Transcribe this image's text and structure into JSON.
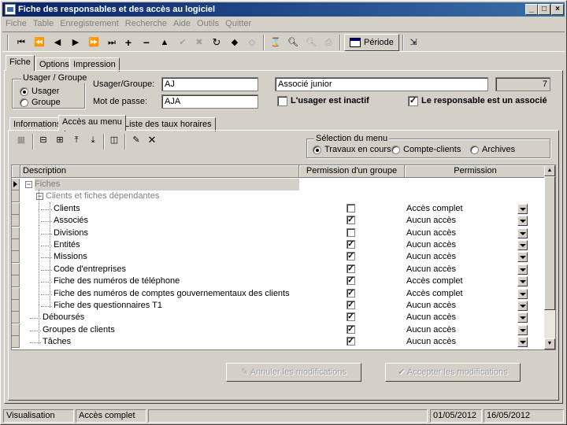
{
  "window": {
    "title": "Fiche des responsables et des accès au logiciel",
    "controls": {
      "minimize": "_",
      "maximize": "□",
      "close": "×"
    }
  },
  "menu": [
    "Fiche",
    "Table",
    "Enregistrement",
    "Recherche",
    "Aide",
    "Outils",
    "Quitter"
  ],
  "toolbar": {
    "periode_label": "Période",
    "icons": [
      "first-record-icon",
      "prev-page-icon",
      "prev-record-icon",
      "next-record-icon",
      "next-page-icon",
      "last-record-icon",
      "add-icon",
      "delete-icon",
      "up-icon",
      "confirm-icon",
      "cancel-icon",
      "refresh-icon",
      "tag-icon",
      "tag-disabled-icon",
      "hourglass-icon",
      "zoom-icon",
      "zoom-disabled-icon",
      "print-icon",
      "calendar-icon",
      "exit-icon"
    ]
  },
  "main_tabs": [
    {
      "label": "Fiche",
      "active": true
    },
    {
      "label": "Options",
      "active": false
    },
    {
      "label": "Impression",
      "active": false
    }
  ],
  "user_group": {
    "legend": "Usager / Groupe",
    "options": [
      {
        "label": "Usager",
        "selected": true
      },
      {
        "label": "Groupe",
        "selected": false
      }
    ],
    "user_label": "Usager/Groupe:",
    "user_value": "AJ",
    "user_desc": "Associé junior",
    "user_id": "7",
    "password_label": "Mot de passe:",
    "password_value": "AJA",
    "inactive_label": "L'usager est inactif",
    "inactive_checked": false,
    "associate_label": "Le responsable est un associé",
    "associate_checked": true
  },
  "sub_tabs": [
    {
      "label": "Informations",
      "active": false
    },
    {
      "label": "Accès au menu",
      "active": true
    },
    {
      "label": "Liste des taux horaires",
      "active": false
    }
  ],
  "menu_selection": {
    "legend": "Sélection du menu",
    "options": [
      {
        "label": "Travaux en cours",
        "selected": true
      },
      {
        "label": "Compte-clients",
        "selected": false
      },
      {
        "label": "Archives",
        "selected": false
      }
    ]
  },
  "grid": {
    "headers": [
      "Description",
      "Permission d'un groupe",
      "Permission"
    ],
    "rows": [
      {
        "label": "Fiches",
        "level": 0,
        "group_checked": null,
        "permission": "",
        "dropdown": false,
        "toggle": "−",
        "dim": true,
        "current": true
      },
      {
        "label": "Clients et fiches dépendantes",
        "level": 1,
        "group_checked": null,
        "permission": "",
        "dropdown": false,
        "toggle": "−",
        "dim": true
      },
      {
        "label": "Clients",
        "level": 2,
        "group_checked": false,
        "permission": "Accès complet",
        "dropdown": true
      },
      {
        "label": "Associés",
        "level": 2,
        "group_checked": true,
        "permission": "Aucun accès",
        "dropdown": true
      },
      {
        "label": "Divisions",
        "level": 2,
        "group_checked": false,
        "permission": "Aucun accès",
        "dropdown": true
      },
      {
        "label": "Entités",
        "level": 2,
        "group_checked": true,
        "permission": "Aucun accès",
        "dropdown": true
      },
      {
        "label": "Missions",
        "level": 2,
        "group_checked": true,
        "permission": "Aucun accès",
        "dropdown": true
      },
      {
        "label": "Code d'entreprises",
        "level": 2,
        "group_checked": true,
        "permission": "Aucun accès",
        "dropdown": true
      },
      {
        "label": "Fiche des numéros de téléphone",
        "level": 2,
        "group_checked": true,
        "permission": "Accès complet",
        "dropdown": true
      },
      {
        "label": "Fiche des numéros de comptes gouvernementaux des clients",
        "level": 2,
        "group_checked": true,
        "permission": "Accès complet",
        "dropdown": true
      },
      {
        "label": "Fiche des questionnaires T1",
        "level": 2,
        "group_checked": true,
        "permission": "Aucun accès",
        "dropdown": true
      },
      {
        "label": "Déboursés",
        "level": 1,
        "group_checked": true,
        "permission": "Aucun accès",
        "dropdown": true
      },
      {
        "label": "Groupes de clients",
        "level": 1,
        "group_checked": true,
        "permission": "Aucun accès",
        "dropdown": true
      },
      {
        "label": "Tâches",
        "level": 1,
        "group_checked": true,
        "permission": "Aucun accès",
        "dropdown": true
      }
    ]
  },
  "buttons": {
    "cancel_label": "Annuler les modifications",
    "accept_label": "Accepter les modifications"
  },
  "status": {
    "mode": "Visualisation",
    "access": "Accès complet",
    "empty": "",
    "date_start": "01/05/2012",
    "date_end": "16/05/2012"
  }
}
